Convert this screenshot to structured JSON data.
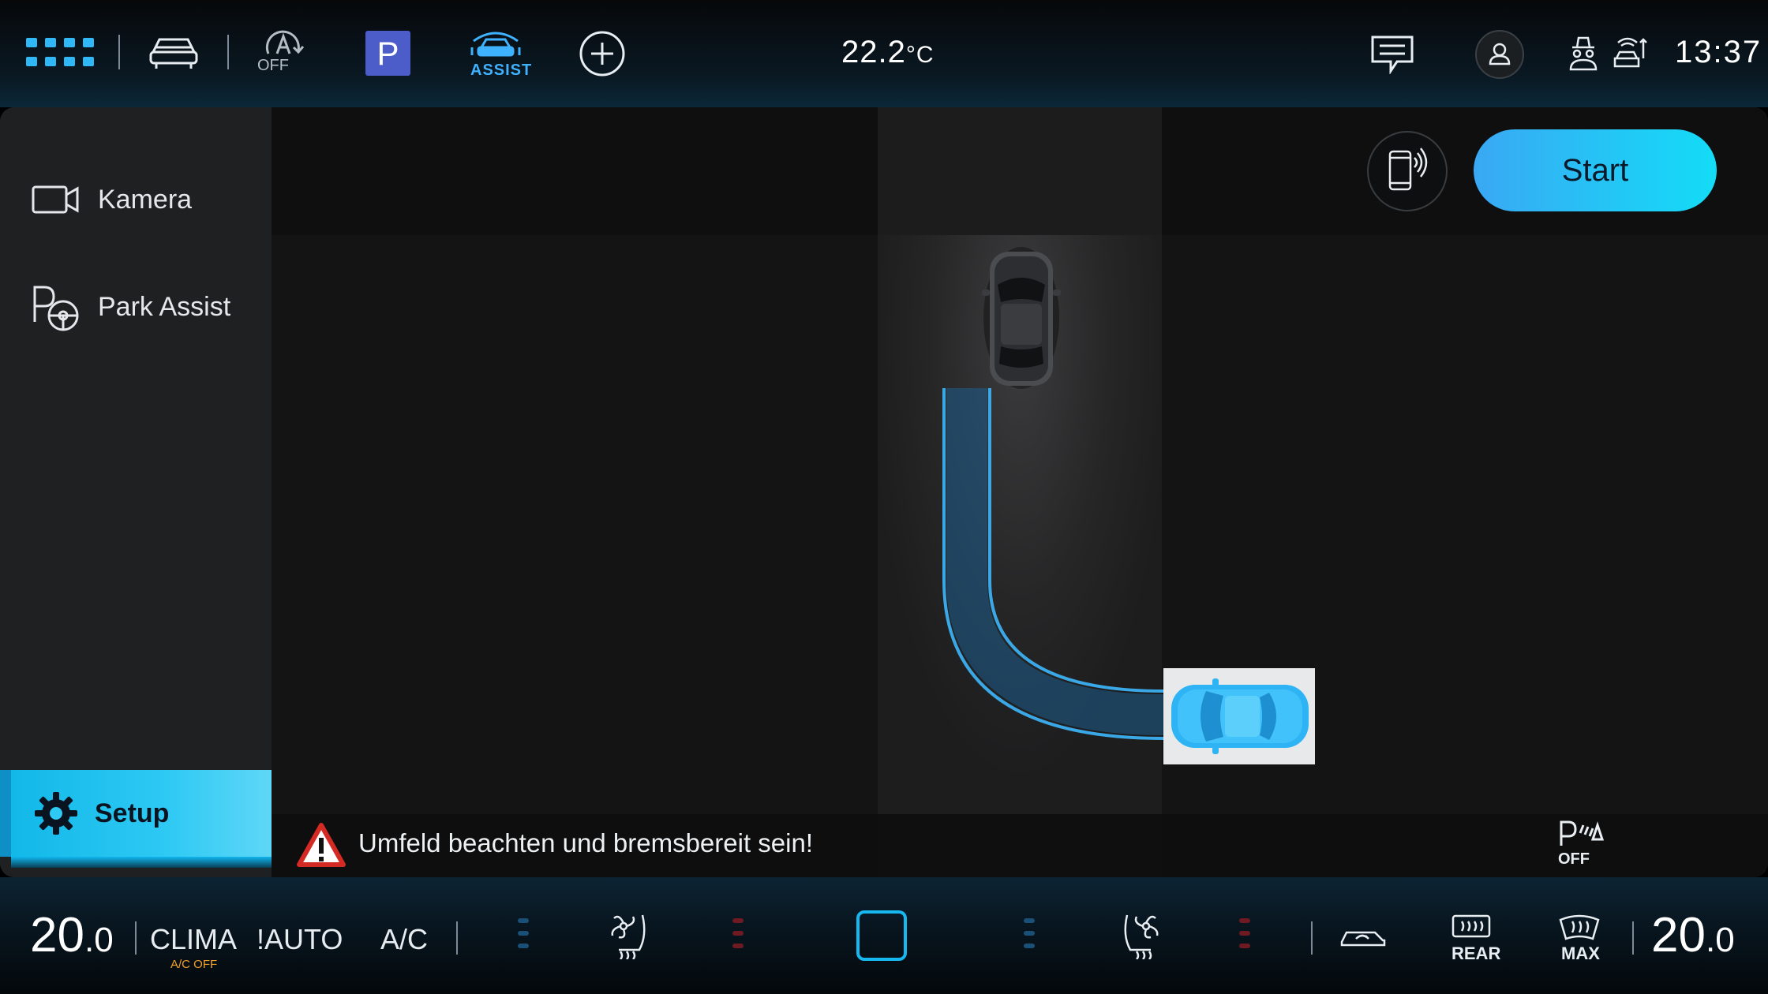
{
  "topbar": {
    "auto_hold_label": "OFF",
    "park_badge": "P",
    "assist_label": "ASSIST",
    "temperature": "22.2",
    "temperature_unit": "°C",
    "clock": "13:37"
  },
  "sidebar": {
    "items": [
      {
        "label": "Kamera",
        "icon": "camera-icon"
      },
      {
        "label": "Park Assist",
        "icon": "park-assist-icon"
      }
    ],
    "setup_label": "Setup"
  },
  "scene": {
    "start_label": "Start",
    "warning_text": "Umfeld beachten und bremsbereit sein!",
    "park_status_label": "OFF",
    "accent_color": "#13dcf6",
    "path_color": "#3aa8e6"
  },
  "climate": {
    "left_temp": "20",
    "left_temp_decimal": ".0",
    "right_temp": "20",
    "right_temp_decimal": ".0",
    "clima_label": "CLIMA",
    "ac_off_label": "A/C OFF",
    "auto_label": "!AUTO",
    "ac_label": "A/C",
    "rear_label": "REAR",
    "max_label": "MAX"
  }
}
